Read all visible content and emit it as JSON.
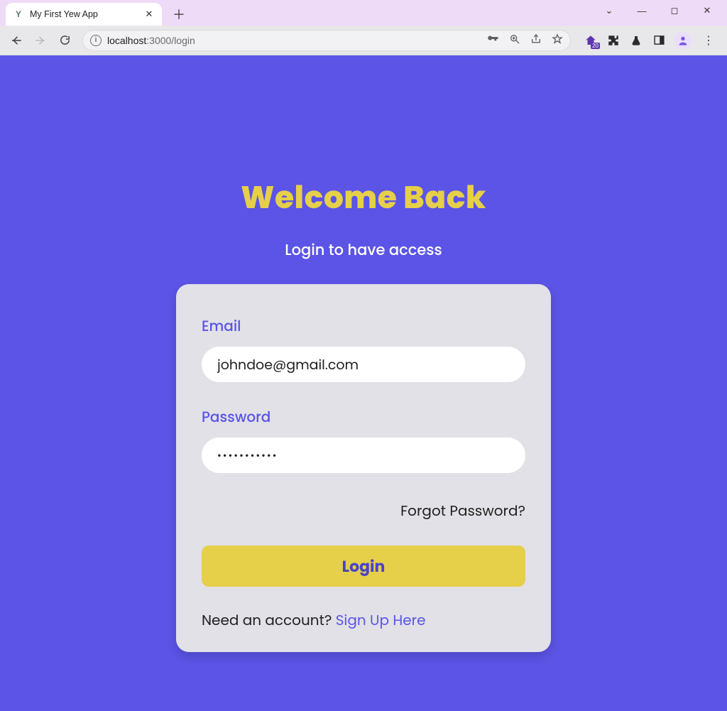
{
  "browser": {
    "tab_title": "My First Yew App",
    "url_host": "localhost",
    "url_port_path": ":3000/login",
    "ext_badge": "20"
  },
  "page": {
    "headline": "Welcome Back",
    "subhead": "Login to have access",
    "email_label": "Email",
    "email_value": "johndoe@gmail.com",
    "password_label": "Password",
    "password_value": "•••••••••••",
    "forgot": "Forgot Password?",
    "login_button": "Login",
    "need_account": "Need an account? ",
    "signup_link": "Sign Up Here"
  }
}
